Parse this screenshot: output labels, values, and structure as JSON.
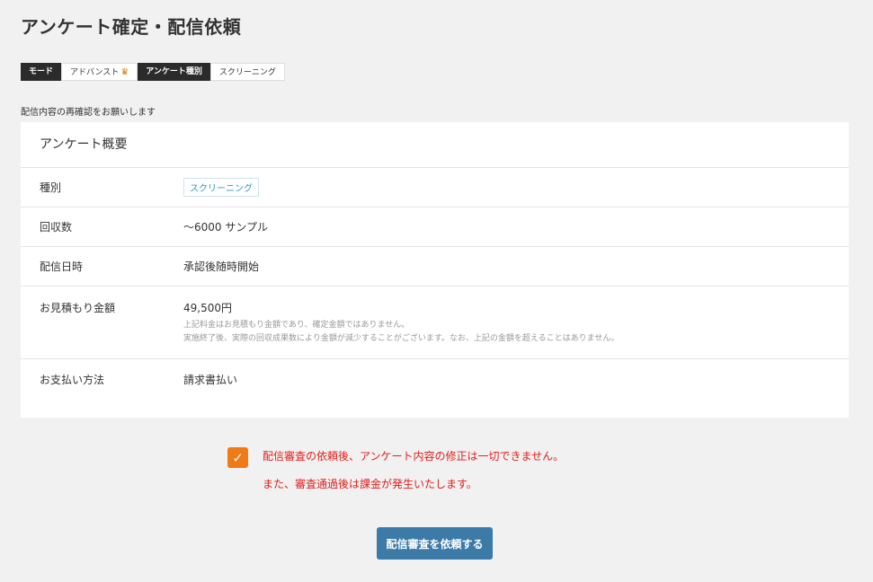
{
  "page_title": "アンケート確定・配信依頼",
  "tags": [
    {
      "label": "モード",
      "style": "dark"
    },
    {
      "label": "アドバンスト",
      "style": "light",
      "icon": "crown-icon"
    },
    {
      "label": "アンケート種別",
      "style": "dark"
    },
    {
      "label": "スクリーニング",
      "style": "light"
    }
  ],
  "notice": "配信内容の再確認をお願いします",
  "summary": {
    "title": "アンケート概要",
    "rows": {
      "type": {
        "label": "種別",
        "value": "スクリーニング"
      },
      "count": {
        "label": "回収数",
        "value": "〜6000 サンプル"
      },
      "schedule": {
        "label": "配信日時",
        "value": "承認後随時開始"
      },
      "estimate": {
        "label": "お見積もり金額",
        "value": "49,500円",
        "note1": "上記料金はお見積もり金額であり、確定金額ではありません。",
        "note2": "実施終了後、実際の回収成果数により金額が減少することがございます。なお、上記の金額を超えることはありません。"
      },
      "payment": {
        "label": "お支払い方法",
        "value": "請求書払い"
      }
    }
  },
  "confirm": {
    "checked": true,
    "line1": "配信審査の依頼後、アンケート内容の修正は一切できません。",
    "line2": "また、審査通過後は課金が発生いたします。"
  },
  "submit_label": "配信審査を依頼する",
  "colors": {
    "accent_orange": "#f07a18",
    "warning_red": "#e0201d",
    "button_blue": "#3c7aa8",
    "badge_blue": "#2a9bc2"
  }
}
